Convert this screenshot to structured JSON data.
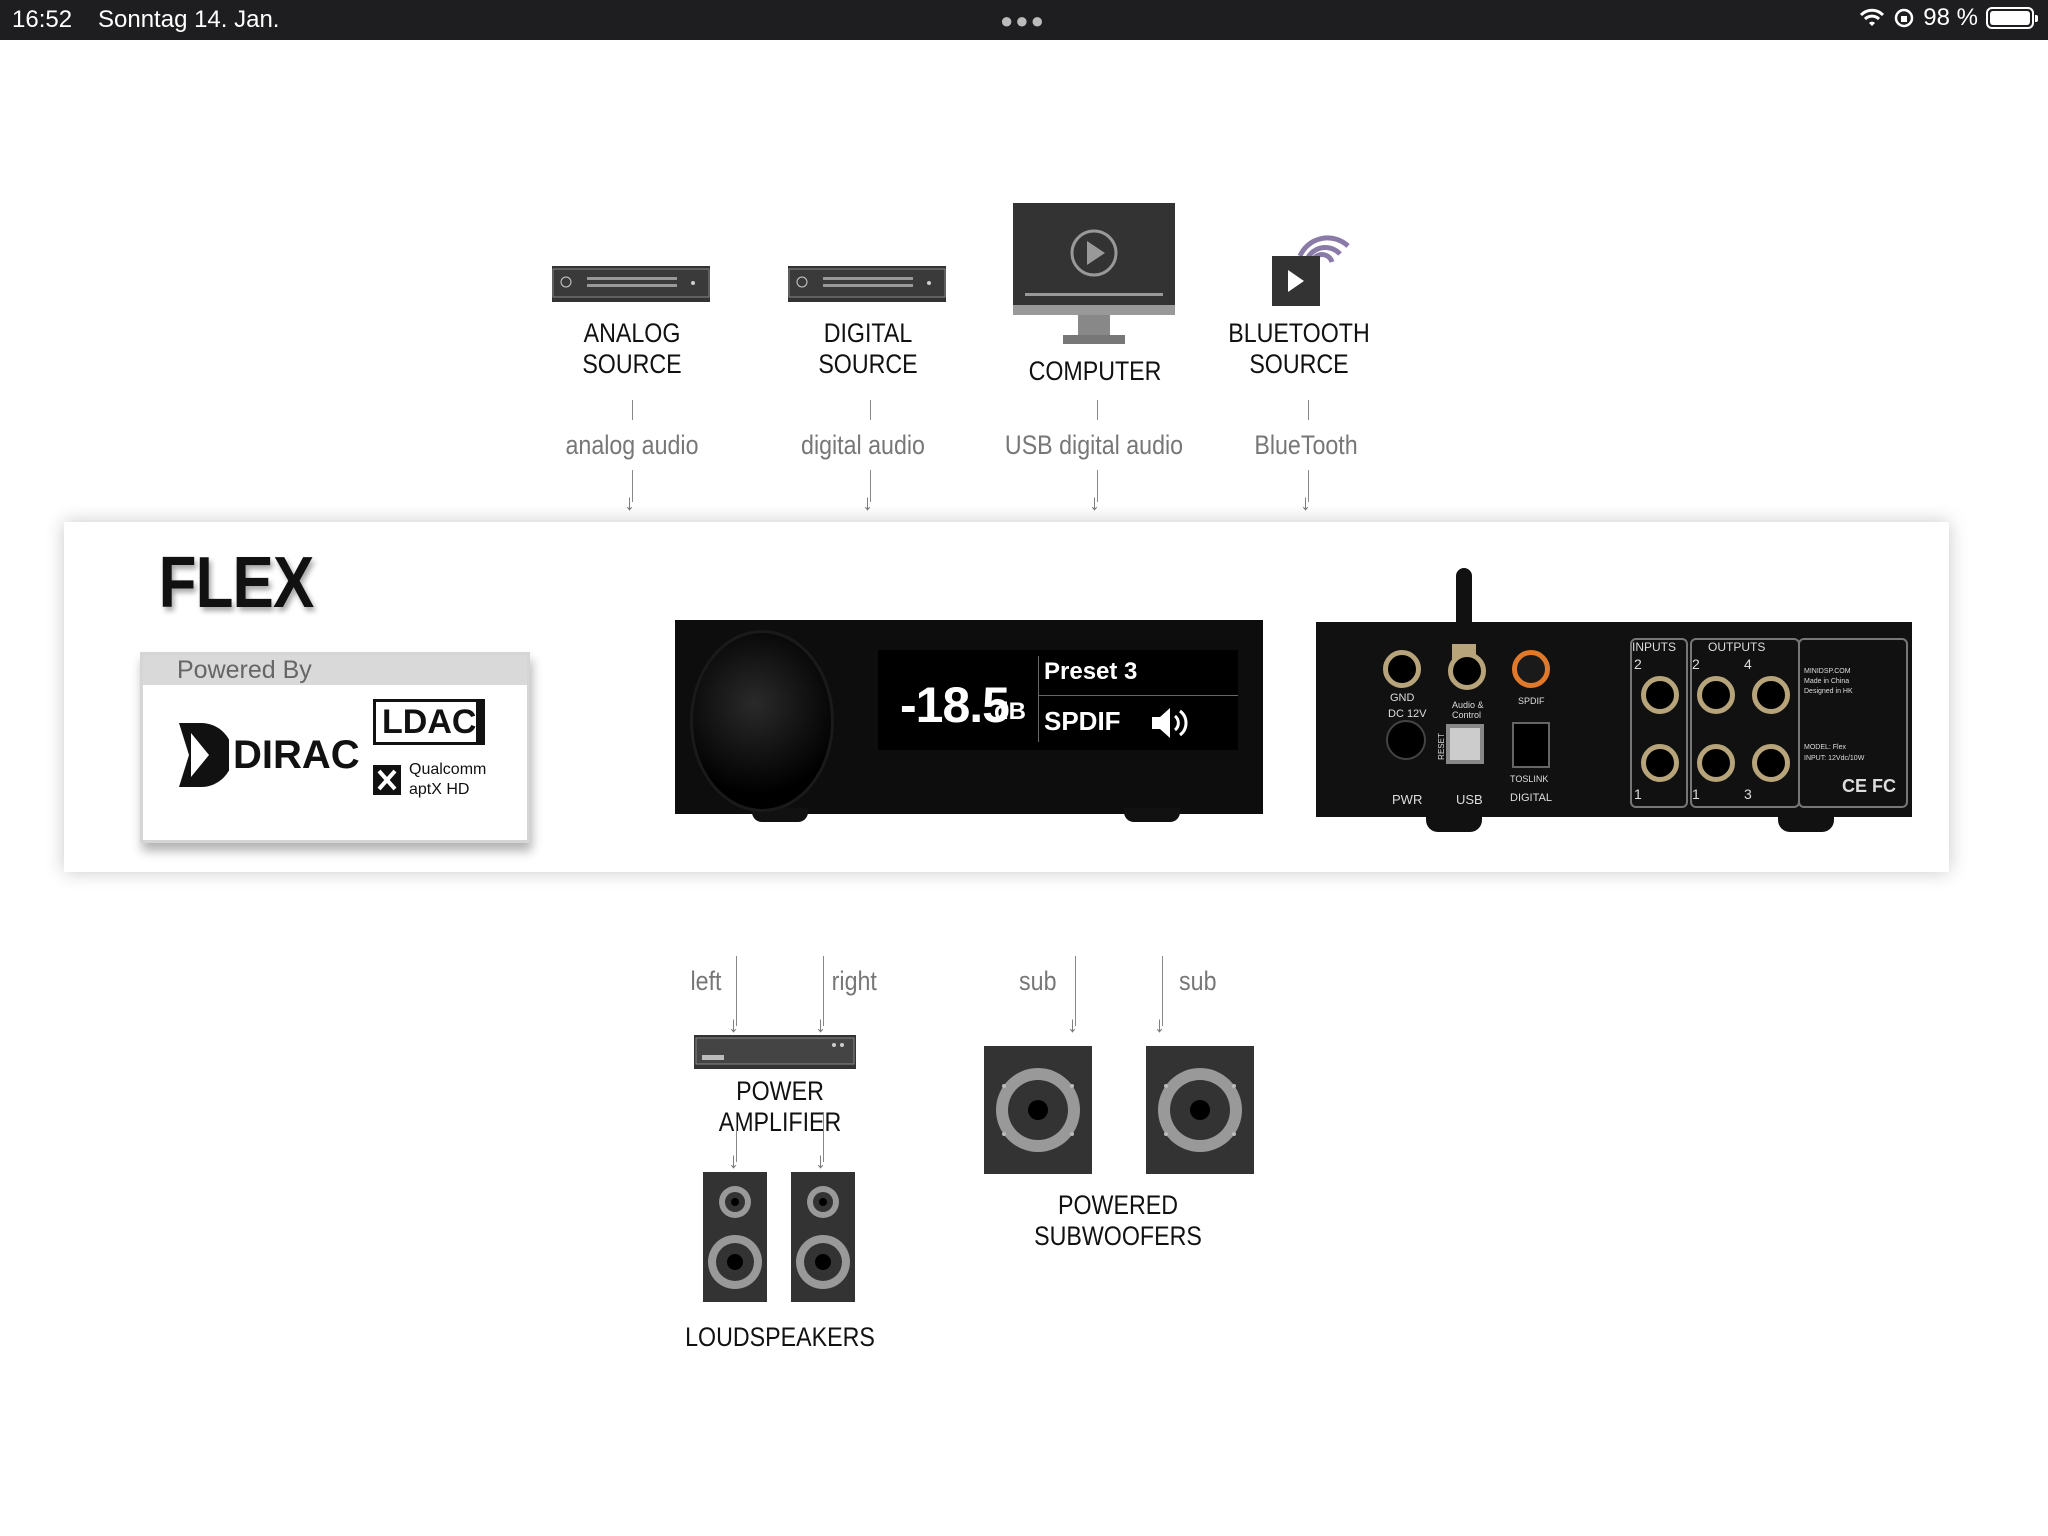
{
  "status_bar": {
    "time": "16:52",
    "date": "Sonntag 14. Jan.",
    "battery": "98 %",
    "battery_level": 0.98
  },
  "sources": [
    {
      "label_line1": "ANALOG",
      "label_line2": "SOURCE",
      "flow": "analog audio",
      "icon": "analog-source-icon"
    },
    {
      "label_line1": "DIGITAL",
      "label_line2": "SOURCE",
      "flow": "digital audio",
      "icon": "digital-source-icon"
    },
    {
      "label_line1": "COMPUTER",
      "label_line2": "",
      "flow": "USB digital audio",
      "icon": "computer-icon"
    },
    {
      "label_line1": "BLUETOOTH",
      "label_line2": "SOURCE",
      "flow": "BlueTooth",
      "icon": "bluetooth-source-icon"
    }
  ],
  "device": {
    "title": "FLEX",
    "powered_by": "Powered By",
    "brand_dirac": "DIRAC",
    "brand_ldac": "LDAC",
    "brand_qualcomm": "Qualcomm",
    "brand_aptx": "aptX HD",
    "display": {
      "volume": "-18.5",
      "unit": "dB",
      "preset": "Preset 3",
      "input": "SPDIF"
    },
    "back_labels": {
      "gnd": "GND",
      "dc": "DC 12V",
      "pwr": "PWR",
      "audio": "Audio &",
      "control": "Control",
      "usb": "USB",
      "spdif": "SPDIF",
      "toslink": "TOSLINK",
      "digital": "DIGITAL",
      "reset": "RESET",
      "inputs": "INPUTS",
      "outputs": "OUTPUTS",
      "in2": "2",
      "in1": "1",
      "out2": "2",
      "out4": "4",
      "out1": "1",
      "out3": "3",
      "model": "MODEL: Flex",
      "input_rating": "INPUT: 12Vdc/10W",
      "site": "MINIDSP.COM",
      "made": "Made in China",
      "designed": "Designed in HK",
      "cert": "CE FC"
    }
  },
  "outputs": {
    "left": "left",
    "right": "right",
    "sub1": "sub",
    "sub2": "sub",
    "amplifier": "POWER AMPLIFIER",
    "loudspeakers": "LOUDSPEAKERS",
    "subwoofers_line1": "POWERED",
    "subwoofers_line2": "SUBWOOFERS"
  },
  "colors": {
    "status_bar": "#1e1e20",
    "bluetooth_waves": "#8a7aa8",
    "gold_jack": "#b8a47a",
    "spdif_jack": "#e07a2a"
  }
}
